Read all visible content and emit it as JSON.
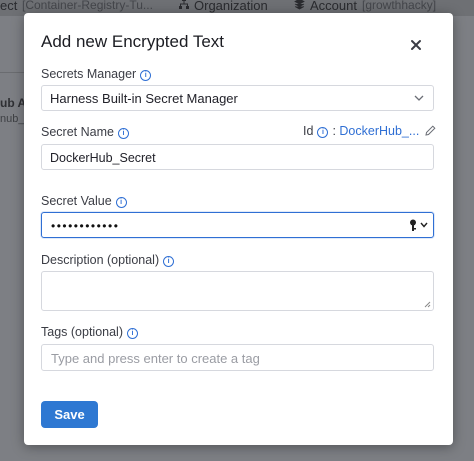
{
  "background": {
    "project_label": "ect",
    "project_value": "[Container-Registry-Tu...",
    "organization": "Organization",
    "account_label": "Account",
    "account_value": "[growthhacky]",
    "left_title": "ub Ac",
    "left_sub": "nub_r"
  },
  "dialog": {
    "title": "Add new Encrypted Text",
    "secrets_manager": {
      "label": "Secrets Manager",
      "value": "Harness Built-in Secret Manager"
    },
    "secret_name": {
      "label": "Secret Name",
      "value": "DockerHub_Secret",
      "id_label": "Id",
      "id_value": "DockerHub_..."
    },
    "secret_value": {
      "label": "Secret Value",
      "masked": "••••••••••••"
    },
    "description": {
      "label": "Description (optional)",
      "value": ""
    },
    "tags": {
      "label": "Tags (optional)",
      "placeholder": "Type and press enter to create a tag"
    },
    "save_label": "Save"
  },
  "colors": {
    "accent": "#2f6fd4",
    "button": "#2e78d2",
    "overlay": "#7d7f84"
  }
}
